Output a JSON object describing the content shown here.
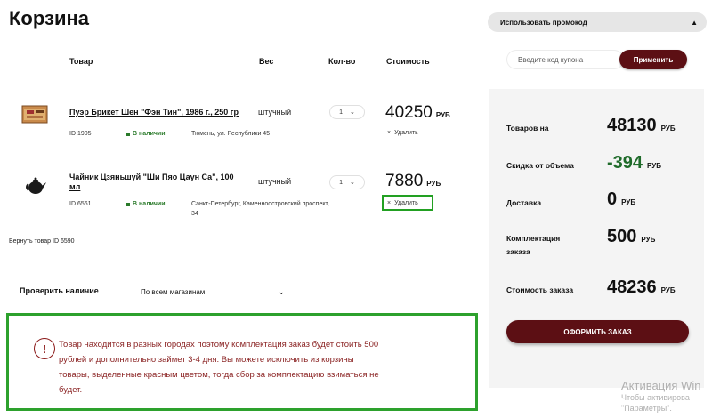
{
  "page": {
    "title": "Корзина"
  },
  "table_headers": {
    "product": "Товар",
    "weight": "Вес",
    "qty": "Кол-во",
    "cost": "Стоимость"
  },
  "items": [
    {
      "name_line1": "Пуэр Брикет Шен \"Фэн Тин\", 1986 г., 250 гр",
      "name_line2": "",
      "id": "ID 1905",
      "stock": "В наличии",
      "address": "Тюмень, ул. Республики 45",
      "weight": "штучный",
      "qty": "1",
      "price": "40250",
      "currency": "РУБ",
      "delete": "Удалить"
    },
    {
      "name_line1": "Чайник Цзяньшуй \"Ши Пяо Цаун Са\", 100",
      "name_line2": "мл",
      "id": "ID 6561",
      "stock": "В наличии",
      "address_line1": "Санкт-Петербург, Каменноостровский проспект,",
      "address_line2": "34",
      "weight": "штучный",
      "qty": "1",
      "price": "7880",
      "currency": "РУБ",
      "delete": "Удалить"
    }
  ],
  "restore_link": "Вернуть товар ID 6590",
  "availability": {
    "label": "Проверить наличие",
    "selected": "По всем магазинам"
  },
  "warning": {
    "line1": "Товар находится в разных городах поэтому комплектация заказ будет стоить 500",
    "line2": "рублей и дополнительно займет 3-4 дня. Вы можете исключить из корзины",
    "line3": "товары, выделенные красным цветом, тогда сбор за комплектацию взиматься не",
    "line4": "будет."
  },
  "promo": {
    "header": "Использовать промокод",
    "placeholder": "Введите код купона",
    "apply": "Применить"
  },
  "summary": {
    "goods_label": "Товаров на",
    "goods_value": "48130",
    "discount_label": "Скидка от объема",
    "discount_value": "-394",
    "delivery_label": "Доставка",
    "delivery_value": "0",
    "assembly_label_line1": "Комплектация",
    "assembly_label_line2": "заказа",
    "assembly_value": "500",
    "total_label": "Стоимость заказа",
    "total_value": "48236",
    "currency": "РУБ",
    "order_button": "ОФОРМИТЬ ЗАКАЗ"
  },
  "windows_watermark": {
    "line1": "Активация Win",
    "line2": "Чтобы активирова",
    "line3": "\"Параметры\"."
  },
  "colors": {
    "brand": "#5c0f14",
    "in_stock": "#2a7a2a",
    "discount": "#1f6b2a",
    "warning_text": "#8b2424",
    "highlight": "#2da12d"
  }
}
